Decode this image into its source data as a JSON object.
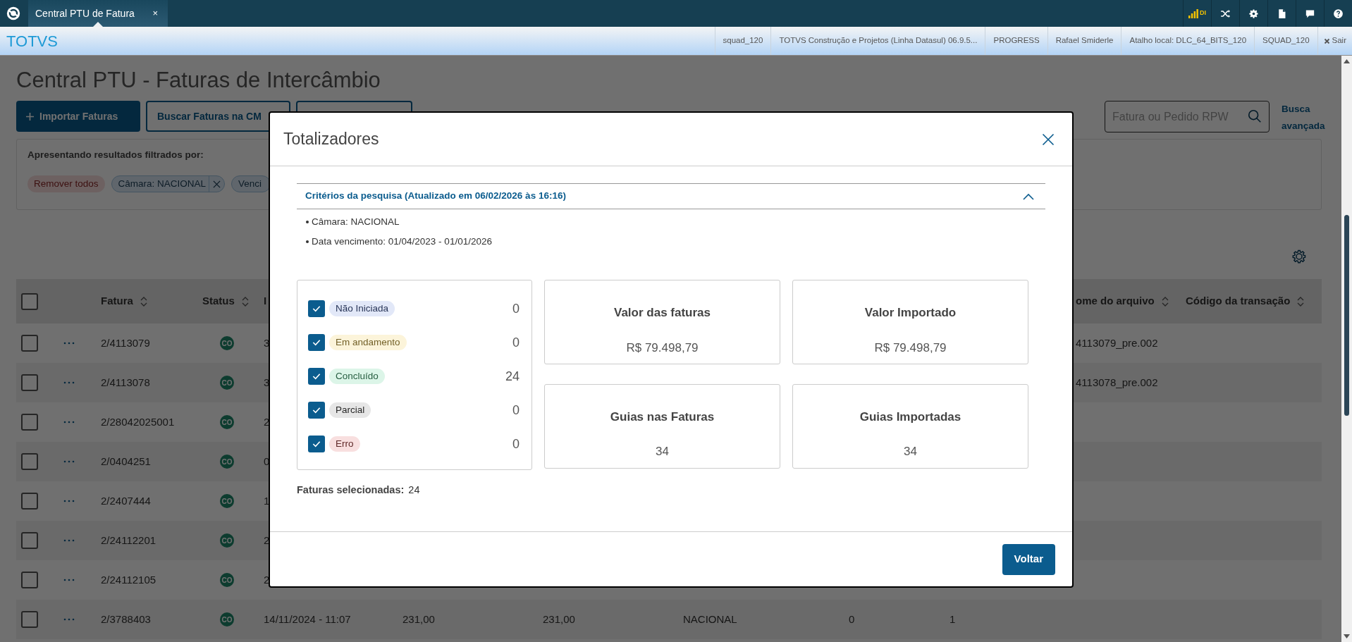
{
  "app_bar": {
    "tab": {
      "title": "Central PTU de Fatura",
      "close": "×",
      "selected": true
    },
    "signal_label": "DI"
  },
  "header": {
    "brand": "TOTVS",
    "info": [
      "squad_120",
      "TOTVS Construção e Projetos (Linha Datasul) 06.9.5...",
      "PROGRESS",
      "Rafael Smiderle",
      "Atalho local: DLC_64_BITS_120",
      "SQUAD_120"
    ],
    "logout": "Sair"
  },
  "page": {
    "title": "Central PTU - Faturas de Intercâmbio",
    "buttons": [
      {
        "kind": "primary",
        "label": "Importar Faturas"
      },
      {
        "kind": "outline",
        "label": "Buscar Faturas na CM"
      },
      {
        "kind": "outline"
      }
    ],
    "search": {
      "placeholder": "Fatura ou Pedido RPW"
    },
    "advanced_search": "Busca avançada",
    "filters": {
      "caption": "Apresentando resultados filtrados por:",
      "remove_all": "Remover todos",
      "chips": [
        {
          "label": "Câmara: NACIONAL",
          "closable": true
        },
        {
          "label": "Venci",
          "closable": false
        }
      ]
    }
  },
  "table": {
    "header": {
      "checked": false,
      "fatura": "Fatura",
      "status": "Status",
      "column_3": "I",
      "file": "ome do arquivo",
      "code": "Código da transação"
    },
    "rows": [
      {
        "checked": false,
        "fatura": "2/4113079",
        "status": "CO",
        "column_3": "3",
        "file": "4113079_pre.002"
      },
      {
        "checked": false,
        "fatura": "2/4113078",
        "status": "CO",
        "column_3": "3",
        "file": "4113078_pre.002"
      },
      {
        "checked": false,
        "fatura": "2/28042025001",
        "status": "CO",
        "column_3": "2"
      },
      {
        "checked": false,
        "fatura": "2/0404251",
        "status": "CO",
        "column_3": "0"
      },
      {
        "checked": false,
        "fatura": "2/2407444",
        "status": "CO",
        "column_3": "1"
      },
      {
        "checked": false,
        "fatura": "2/24112201",
        "status": "CO",
        "column_3": "2"
      },
      {
        "checked": false,
        "fatura": "2/24112105",
        "status": "CO",
        "column_3": "2"
      },
      {
        "checked": false,
        "fatura": "2/3788403",
        "status": "CO",
        "column_3": "14/11/2024 - 11:07",
        "column_4": "231,00",
        "column_5": "231,00",
        "column_6": "NACIONAL",
        "column_7": "0",
        "column_8": "1"
      }
    ]
  },
  "modal": {
    "title": "Totalizadores",
    "criteria": {
      "title": "Critérios da pesquisa (Atualizado em 06/02/2026 às 16:16)",
      "expanded": true,
      "items": [
        "Câmara: NACIONAL",
        "Data vencimento: 01/04/2023 - 01/01/2026"
      ]
    },
    "statuses": [
      {
        "label": "Não Iniciada",
        "checked": true,
        "count": "0",
        "color": "#e2e8f8"
      },
      {
        "label": "Em andamento",
        "checked": true,
        "count": "0",
        "color": "#fcf4da"
      },
      {
        "label": "Concluído",
        "checked": true,
        "count": "24",
        "color": "#dcf5e8"
      },
      {
        "label": "Parcial",
        "checked": true,
        "count": "0",
        "color": "#e6e6e6"
      },
      {
        "label": "Erro",
        "checked": true,
        "count": "0",
        "color": "#f8dfdf"
      }
    ],
    "totals": [
      {
        "title": "Valor das faturas",
        "value": "R$ 79.498,79"
      },
      {
        "title": "Valor Importado",
        "value": "R$ 79.498,79"
      },
      {
        "title": "Guias nas Faturas",
        "value": "34"
      },
      {
        "title": "Guias Importadas",
        "value": "34"
      }
    ],
    "selected_label": "Faturas selecionadas:",
    "selected_count": "24",
    "back_button": "Voltar"
  }
}
